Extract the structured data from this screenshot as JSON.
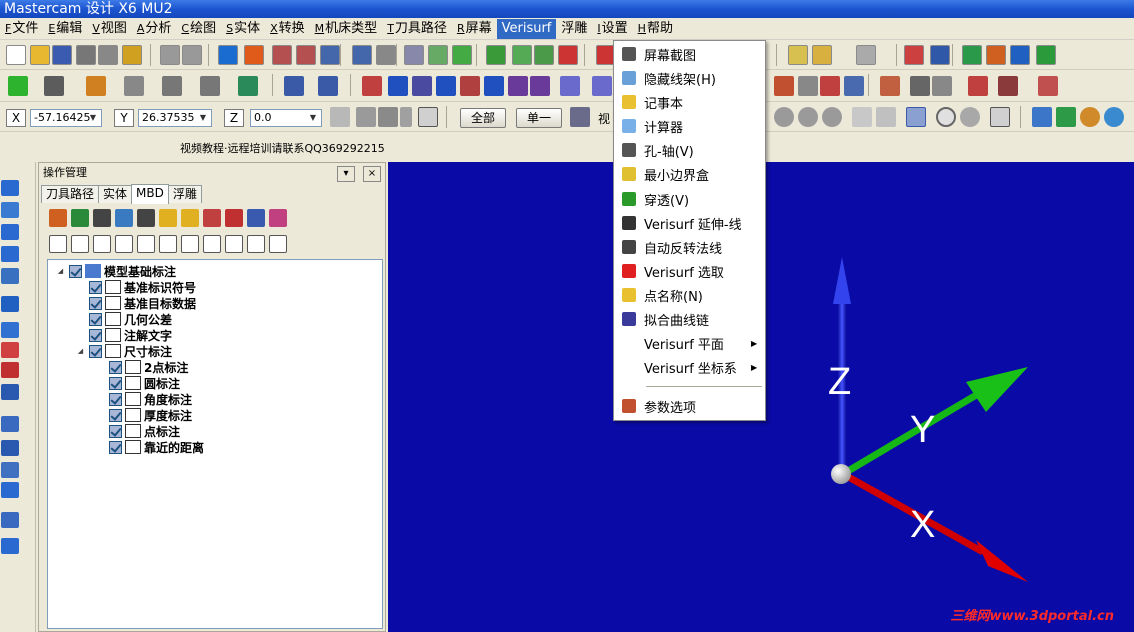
{
  "window": {
    "title": "Mastercam 设计 X6 MU2"
  },
  "menubar": [
    {
      "acc": "F",
      "label": "文件"
    },
    {
      "acc": "E",
      "label": "编辑"
    },
    {
      "acc": "V",
      "label": "视图"
    },
    {
      "acc": "A",
      "label": "分析"
    },
    {
      "acc": "C",
      "label": "绘图"
    },
    {
      "acc": "S",
      "label": "实体"
    },
    {
      "acc": "X",
      "label": "转换"
    },
    {
      "acc": "M",
      "label": "机床类型"
    },
    {
      "acc": "T",
      "label": "刀具路径"
    },
    {
      "acc": "R",
      "label": "屏幕"
    },
    {
      "acc": "",
      "label": "Verisurf"
    },
    {
      "acc": "",
      "label": "浮雕"
    },
    {
      "acc": "I",
      "label": "设置"
    },
    {
      "acc": "H",
      "label": "帮助"
    }
  ],
  "coords": {
    "x_label": "X",
    "x_value": "-57.16425",
    "y_label": "Y",
    "y_value": "26.37535",
    "z_label": "Z",
    "z_value": "0.0"
  },
  "selection_buttons": {
    "all": "全部",
    "single": "单一",
    "partial": "视"
  },
  "infoline": "视频教程·远程培训请联系QQ369292215",
  "ops_manager": {
    "title": "操作管理",
    "min_btn": "▾",
    "close_btn": "×",
    "tabs": [
      "刀具路径",
      "实体",
      "MBD",
      "浮雕"
    ],
    "active_tab": "MBD",
    "tree": [
      {
        "label": "模型基础标注",
        "icon": "model-base-icon",
        "level": 0
      },
      {
        "label": "基准标识符号",
        "icon": "datum-symbol-icon",
        "level": 1
      },
      {
        "label": "基准目标数据",
        "icon": "datum-target-icon",
        "level": 1
      },
      {
        "label": "几何公差",
        "icon": "geometric-tolerance-icon",
        "level": 1
      },
      {
        "label": "注解文字",
        "icon": "note-text-icon",
        "level": 1
      },
      {
        "label": "尺寸标注",
        "icon": "dimension-icon",
        "level": 1
      },
      {
        "label": "2点标注",
        "icon": "two-point-dim-icon",
        "level": 2
      },
      {
        "label": "圆标注",
        "icon": "circle-dim-icon",
        "level": 2
      },
      {
        "label": "角度标注",
        "icon": "angle-dim-icon",
        "level": 2
      },
      {
        "label": "厚度标注",
        "icon": "thickness-dim-icon",
        "level": 2
      },
      {
        "label": "点标注",
        "icon": "point-dim-icon",
        "level": 2
      },
      {
        "label": "靠近的距离",
        "icon": "near-distance-icon",
        "level": 2
      }
    ]
  },
  "verisurf_menu": {
    "items": [
      {
        "label": "屏幕截图",
        "icon": "screenshot-icon",
        "submenu": false
      },
      {
        "label": "隐藏线架(H)",
        "icon": "hide-wireframe-icon",
        "submenu": false
      },
      {
        "label": "记事本",
        "icon": "notepad-icon",
        "submenu": false
      },
      {
        "label": "计算器",
        "icon": "calculator-icon",
        "submenu": false
      },
      {
        "label": "孔-轴(V)",
        "icon": "hole-shaft-icon",
        "submenu": false
      },
      {
        "label": "最小边界盒",
        "icon": "bounding-box-icon",
        "submenu": false
      },
      {
        "label": "穿透(V)",
        "icon": "pierce-icon",
        "submenu": false
      },
      {
        "label": "Verisurf 延伸-线",
        "icon": "extend-line-icon",
        "submenu": false
      },
      {
        "label": "自动反转法线",
        "icon": "flip-normal-icon",
        "submenu": false
      },
      {
        "label": "Verisurf 选取",
        "icon": "verisurf-select-icon",
        "submenu": false
      },
      {
        "label": "点名称(N)",
        "icon": "point-name-icon",
        "submenu": false
      },
      {
        "label": "拟合曲线链",
        "icon": "fit-curve-icon",
        "submenu": false
      },
      {
        "label": "Verisurf 平面",
        "icon": "",
        "submenu": true
      },
      {
        "label": "Verisurf 坐标系",
        "icon": "",
        "submenu": true
      },
      {
        "label": "参数选项",
        "icon": "options-icon",
        "submenu": false
      }
    ]
  },
  "viewport": {
    "background_color": "#0a0aa6",
    "axes": {
      "x_label": "X",
      "y_label": "Y",
      "z_label": "Z"
    },
    "axis_colors": {
      "x": "#d40000",
      "y": "#12b012",
      "z": "#2233dd"
    },
    "watermark": "三维网www.3dportal.cn"
  }
}
